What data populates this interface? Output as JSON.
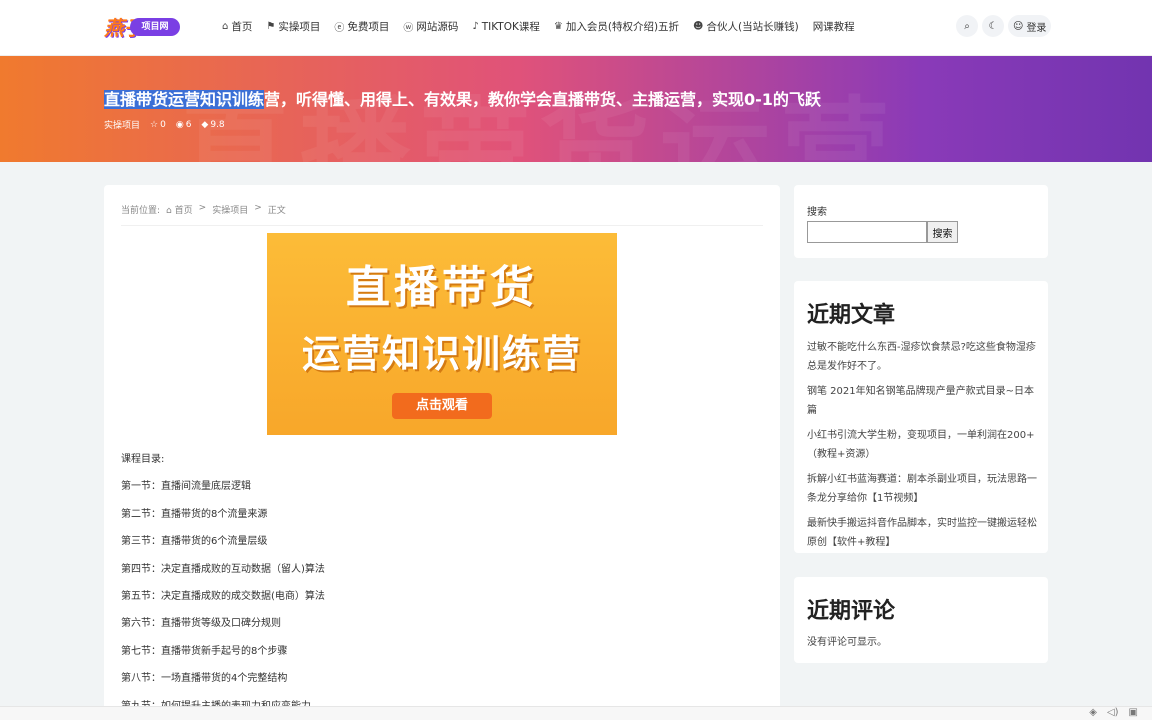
{
  "logo": {
    "hanzi": "燕子",
    "pill": "项目网"
  },
  "nav": [
    {
      "icon": "⌂",
      "label": "首页"
    },
    {
      "icon": "⚑",
      "label": "实操项目"
    },
    {
      "icon": "ⓔ",
      "label": "免费项目"
    },
    {
      "icon": "ⓦ",
      "label": "网站源码"
    },
    {
      "icon": "♪",
      "label": "TIKTOK课程"
    },
    {
      "icon": "♛",
      "label": "加入会员(特权介绍)五折"
    },
    {
      "icon": "☻",
      "label": "合伙人(当站长赚钱)"
    },
    {
      "icon": "",
      "label": "网课教程"
    }
  ],
  "tools": {
    "search_icon": "⌕",
    "theme_icon": "☾",
    "user_icon": "☺",
    "login_label": "登录"
  },
  "banner": {
    "title_highlight": "直播带货运营知识训练",
    "title_rest": "营，听得懂、用得上、有效果，教你学会直播带货、主播运营，实现0-1的飞跃",
    "bg_text": "直播带货运营",
    "category": "实操项目",
    "stars": "0",
    "views": "6",
    "score": "9.8"
  },
  "breadcrumb": {
    "prefix": "当前位置:",
    "home": "首页",
    "sep": ">",
    "category": "实操项目",
    "current": "正文"
  },
  "hero": {
    "line1": "直播带货",
    "line2": "运营知识训练营",
    "button": "点击观看"
  },
  "content": {
    "toc_title": "课程目录:",
    "lines": [
      "第一节：直播间流量底层逻辑",
      "第二节：直播带货的8个流量来源",
      "第三节：直播带货的6个流量层级",
      "第四节：决定直播成败的互动数据（留人)算法",
      "第五节：决定直播成败的成交数据(电商）算法",
      "第六节：直播带货等级及口碑分规则",
      "第七节：直播带货新手起号的8个步骤",
      "第八节：一场直播带货的4个完整结构",
      "第九节：如何提升主播的表现力和应变能力"
    ]
  },
  "sidebar": {
    "search_label": "搜索",
    "search_value": "",
    "search_button": "搜索",
    "recent_posts_title": "近期文章",
    "recent_posts": [
      "过敏不能吃什么东西-湿疹饮食禁忌?吃这些食物湿疹总是发作好不了。",
      "钢笔 2021年知名钢笔品牌现产量产款式目录~日本篇",
      "小红书引流大学生粉，变现项目，一单利润在200+（教程+资源）",
      "拆解小红书蓝海赛道：剧本杀副业项目，玩法思路一条龙分享给你【1节视频】",
      "最新快手搬运抖音作品脚本，实时监控一键搬运轻松原创【软件+教程】"
    ],
    "recent_comments_title": "近期评论",
    "no_comments": "没有评论可显示。"
  },
  "colors": {
    "accent": "#7a3fe4",
    "banner_start": "#f07a2e",
    "banner_end": "#7234b0",
    "hero_orange": "#f8a72a"
  }
}
